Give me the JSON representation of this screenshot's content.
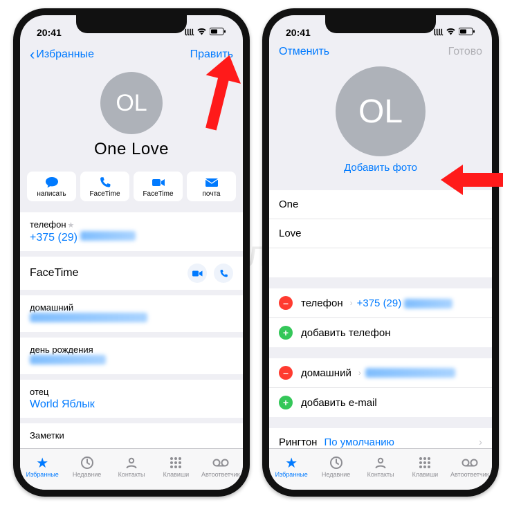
{
  "watermark": "Яблык",
  "statusbar": {
    "time": "20:41"
  },
  "left": {
    "nav": {
      "back": "Избранные",
      "edit": "Править"
    },
    "avatar_initials": "OL",
    "contact_name": "One Love",
    "apple_mark": "",
    "actions": {
      "message": "написать",
      "facetime_audio": "FaceTime",
      "facetime_video": "FaceTime",
      "mail": "почта"
    },
    "phone": {
      "label": "телефон",
      "value_visible": "+375 (29)"
    },
    "facetime_label": "FaceTime",
    "home_email": {
      "label": "домашний"
    },
    "birthday": {
      "label": "день рождения"
    },
    "father": {
      "label": "отец",
      "value": "World Яблык"
    },
    "notes_label": "Заметки"
  },
  "right": {
    "nav": {
      "cancel": "Отменить",
      "done": "Готово"
    },
    "avatar_initials": "OL",
    "add_photo": "Добавить фото",
    "first_name": "One",
    "last_name": "Love",
    "company_mark": "",
    "phone_field": {
      "label": "телефон",
      "value_visible": "+375 (29)"
    },
    "add_phone": "добавить телефон",
    "home_field": {
      "label": "домашний"
    },
    "add_email": "добавить e-mail",
    "ringtone": {
      "label": "Рингтон",
      "value": "По умолчанию"
    }
  },
  "tabs": {
    "favorites": "Избранные",
    "recents": "Недавние",
    "contacts": "Контакты",
    "keypad": "Клавиши",
    "voicemail": "Автоответчик"
  },
  "icons": {
    "back_chevron": "‹",
    "signal": "▪▪▪▪",
    "wifi": "⧉",
    "battery": "▭"
  }
}
